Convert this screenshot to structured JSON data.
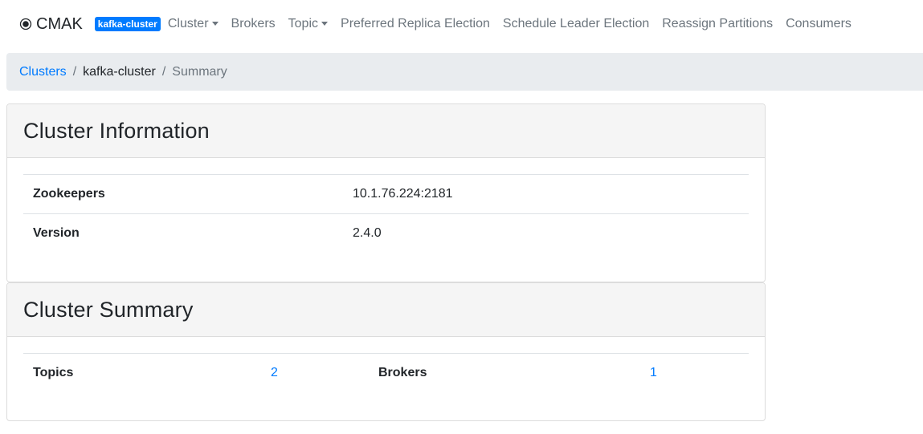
{
  "navbar": {
    "brand": "CMAK",
    "cluster_badge": "kafka-cluster",
    "items": [
      {
        "label": "Cluster",
        "dropdown": true
      },
      {
        "label": "Brokers",
        "dropdown": false
      },
      {
        "label": "Topic",
        "dropdown": true
      },
      {
        "label": "Preferred Replica Election",
        "dropdown": false
      },
      {
        "label": "Schedule Leader Election",
        "dropdown": false
      },
      {
        "label": "Reassign Partitions",
        "dropdown": false
      },
      {
        "label": "Consumers",
        "dropdown": false
      }
    ]
  },
  "breadcrumb": {
    "items": [
      "Clusters",
      "kafka-cluster",
      "Summary"
    ],
    "separator": "/"
  },
  "cluster_information": {
    "title": "Cluster Information",
    "rows": [
      {
        "label": "Zookeepers",
        "value": "10.1.76.224:2181"
      },
      {
        "label": "Version",
        "value": "2.4.0"
      }
    ]
  },
  "cluster_summary": {
    "title": "Cluster Summary",
    "topics_label": "Topics",
    "topics_value": "2",
    "brokers_label": "Brokers",
    "brokers_value": "1"
  },
  "colors": {
    "link": "#007bff",
    "badge": "#007bff",
    "nav_text": "#6c757d",
    "breadcrumb_bg": "#e9ecef",
    "card_header_bg": "#f5f5f5"
  },
  "icons": {
    "brand": "radio-target-icon",
    "dropdown": "caret-down-icon"
  }
}
